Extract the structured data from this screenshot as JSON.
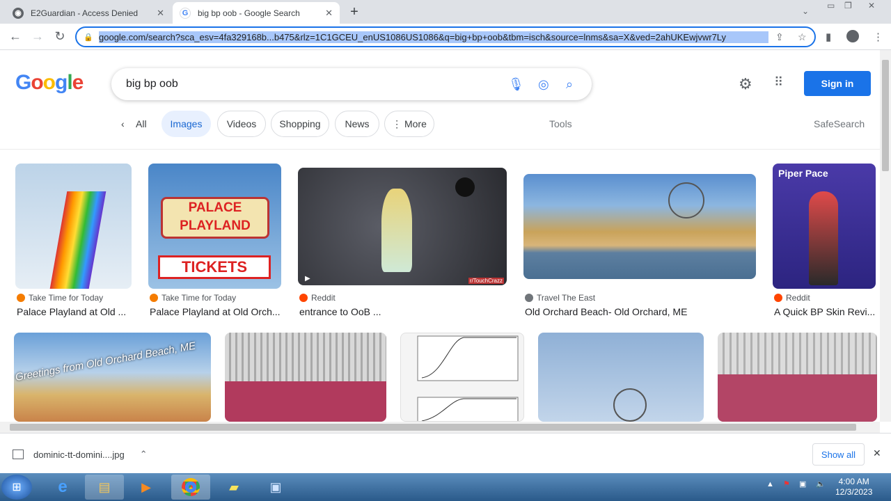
{
  "tabs": [
    {
      "title": "E2Guardian - Access Denied"
    },
    {
      "title": "big bp oob - Google Search"
    }
  ],
  "omnibox": {
    "url": "google.com/search?sca_esv=4fa329168b...b475&rlz=1C1GCEU_enUS1086US1086&q=big+bp+oob&tbm=isch&source=lnms&sa=X&ved=2ahUKEwjvwr7Ly"
  },
  "google": {
    "logo": "Google",
    "query": "big bp oob",
    "sign_in": "Sign in"
  },
  "filters": {
    "all": "All",
    "images": "Images",
    "videos": "Videos",
    "shopping": "Shopping",
    "news": "News",
    "more": "More",
    "tools": "Tools",
    "safesearch": "SafeSearch"
  },
  "results": [
    {
      "source": "Take Time for Today",
      "title": "Palace Playland at Old ..."
    },
    {
      "source": "Take Time for Today",
      "title": "Palace Playland at Old Orch..."
    },
    {
      "source": "Reddit",
      "title": "entrance to OoB ..."
    },
    {
      "source": "Travel The East",
      "title": "Old Orchard Beach- Old Orchard, ME"
    },
    {
      "source": "Reddit",
      "title": "A Quick BP Skin Revi..."
    }
  ],
  "image_text": {
    "palace": "PALACE",
    "playland": "PLAYLAND",
    "tickets": "TICKETS",
    "watermark": "r/TouchCrazz",
    "greetings": "Greetings from Old Orchard Beach, ME",
    "piper": "Piper Pace"
  },
  "download": {
    "file": "dominic-tt-domini....jpg",
    "show_all": "Show all"
  },
  "clock": {
    "time": "4:00 AM",
    "date": "12/3/2023"
  }
}
